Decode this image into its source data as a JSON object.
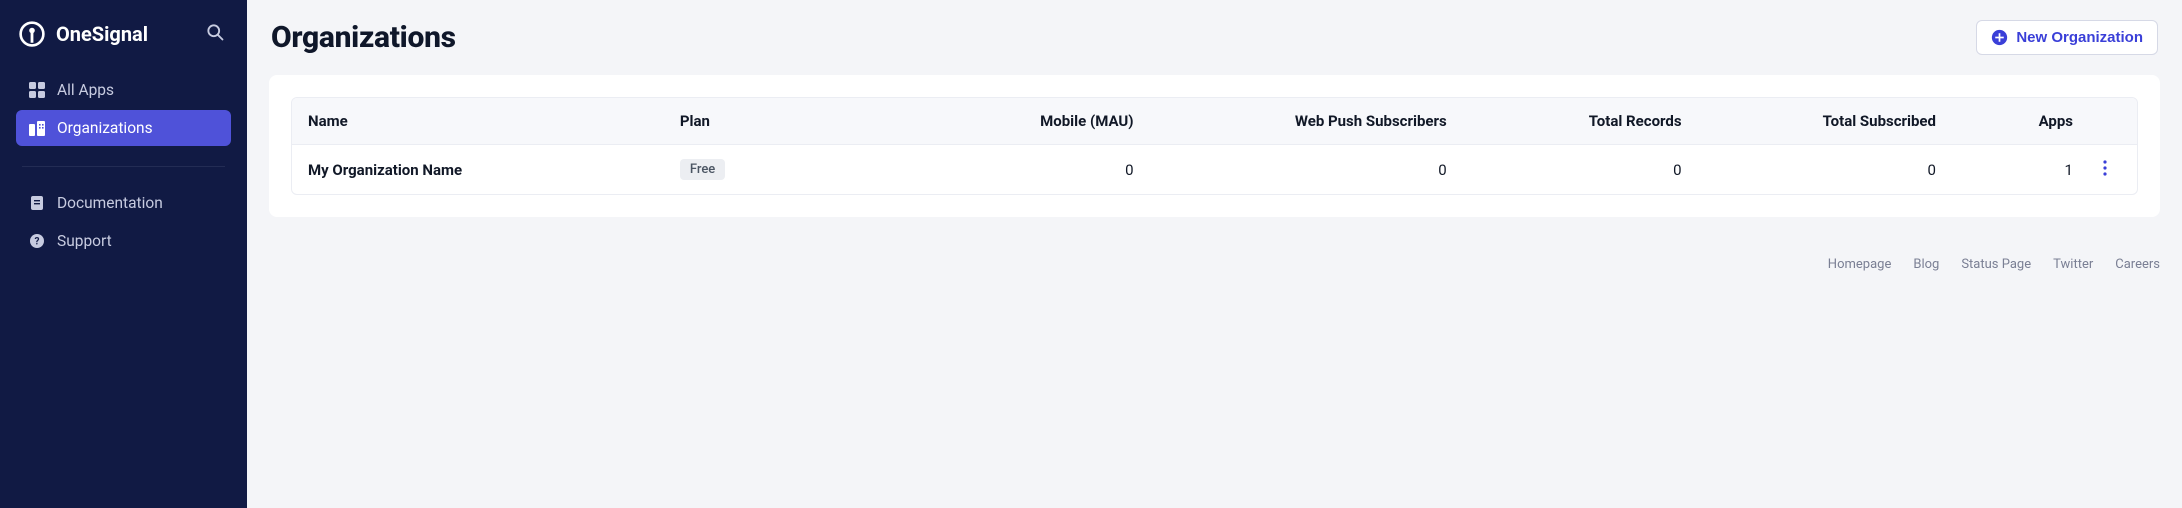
{
  "brand": {
    "name": "OneSignal"
  },
  "sidebar": {
    "items": [
      {
        "label": "All Apps"
      },
      {
        "label": "Organizations"
      }
    ],
    "secondary": [
      {
        "label": "Documentation"
      },
      {
        "label": "Support"
      }
    ]
  },
  "header": {
    "title": "Organizations",
    "new_button": "New Organization"
  },
  "table": {
    "columns": {
      "name": "Name",
      "plan": "Plan",
      "mobile": "Mobile (MAU)",
      "web": "Web Push Subscribers",
      "total_records": "Total Records",
      "total_subscribed": "Total Subscribed",
      "apps": "Apps"
    },
    "rows": [
      {
        "name": "My Organization Name",
        "plan": "Free",
        "mobile": "0",
        "web": "0",
        "total_records": "0",
        "total_subscribed": "0",
        "apps": "1"
      }
    ]
  },
  "footer": {
    "links": [
      "Homepage",
      "Blog",
      "Status Page",
      "Twitter",
      "Careers"
    ]
  }
}
